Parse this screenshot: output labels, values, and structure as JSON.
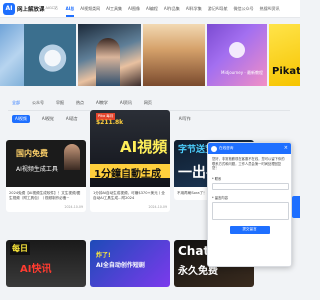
{
  "header": {
    "logo_mark": "AI",
    "title": "网上解放课",
    "subtitle": "AIGC站",
    "nav": [
      "AI总",
      "AI视频类网",
      "AI工具集",
      "AI图像",
      "AI编程",
      "AI作品集",
      "AI科学集",
      "游记AI导航",
      "微信公众号",
      "热搜AI资讯"
    ],
    "active_index": 0
  },
  "banner": {
    "items": [
      {
        "label": ""
      },
      {
        "label": ""
      },
      {
        "label": ""
      },
      {
        "label": ""
      },
      {
        "label": "Midjourney · 最新教程"
      },
      {
        "label": "Pikat"
      }
    ]
  },
  "categories": {
    "row1": [
      "全部",
      "公众号",
      "早报",
      "热点",
      "AI教学",
      "AI资讯",
      "网页"
    ],
    "row1_active": 0,
    "row2": [
      "AI视频",
      "AI视觉",
      "AI语言",
      "B站",
      "抖音",
      "AI教学",
      "Prompt",
      "AI写作"
    ],
    "row2_active": 0
  },
  "cards": [
    {
      "thumb_lines": [
        "国内免费",
        "AI视频生成工具"
      ],
      "text": "2024免费【AI视频生成软件】！文生视频/图生视频（附工具包）丨视频制作必备~",
      "meta_left": "",
      "meta_right": "2024-10-09"
    },
    {
      "thumb_lines": [
        "Pika 每月",
        "$211.8k",
        "AI視頻",
        "1分鐘自動生成"
      ],
      "text": "1分钟AI自动生成视频，可赚$370+美元丨全自动AI工具生成...附2024",
      "meta_left": "",
      "meta_right": "2024-10-09"
    },
    {
      "thumb_lines": [
        "字节送宝了",
        "一出手"
      ],
      "text": "不用再刷Sora了！字节跳动发布视频生成...",
      "meta_left": "",
      "meta_right": ""
    },
    {
      "thumb_lines": [
        "每日",
        "AI快讯"
      ],
      "text": "",
      "meta_left": "",
      "meta_right": ""
    },
    {
      "thumb_lines": [
        "炸了!",
        "AI全自动创作短剧"
      ],
      "text": "",
      "meta_left": "",
      "meta_right": ""
    },
    {
      "thumb_lines": [
        "ChatGP",
        "永久免费"
      ],
      "text": "",
      "meta_left": "",
      "meta_right": ""
    }
  ],
  "chat": {
    "title": "在线咨询",
    "close": "×",
    "message": "您好，非常抱歉现在客服不在线，您可以留下你的联系方式和问题，工作人员会第一时间处理回复您！",
    "contact_label": "* 联系",
    "contact_placeholder": "",
    "message_label": "* 留言内容",
    "message_placeholder": "",
    "submit": "提交留言"
  }
}
